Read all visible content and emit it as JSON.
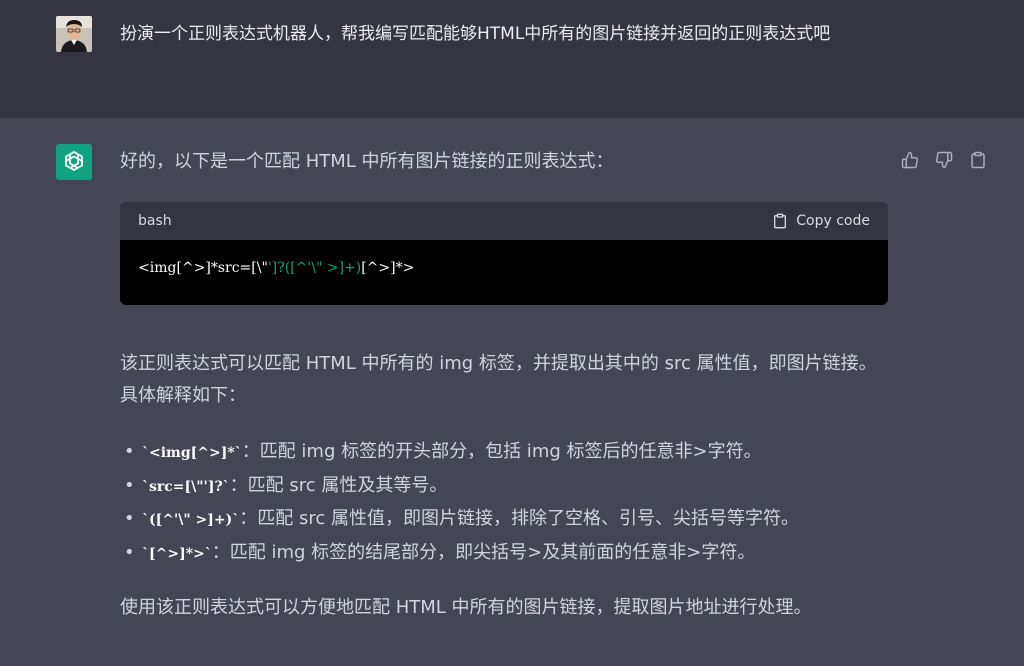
{
  "user_message": {
    "text": "扮演一个正则表达式机器人，帮我编写匹配能够HTML中所有的图片链接并返回的正则表达式吧"
  },
  "assistant_message": {
    "intro": "好的，以下是一个匹配 HTML 中所有图片链接的正则表达式：",
    "code_block": {
      "language": "bash",
      "copy_label": "Copy code",
      "code_part1": "<img[^>]*src=[\\\"",
      "code_part2": "']?([^'\\\" >]+)",
      "code_part3": "[^>]*>"
    },
    "explanation": "该正则表达式可以匹配 HTML 中所有的 img 标签，并提取出其中的 src 属性值，即图片链接。具体解释如下：",
    "bullets": [
      {
        "code": "`<img[^>]*`",
        "text": "：匹配 img 标签的开头部分，包括 img 标签后的任意非>字符。"
      },
      {
        "code": "`src=[\\\"']?`",
        "text": "：匹配 src 属性及其等号。"
      },
      {
        "code": "`([^'\\\" >]+)`",
        "text": "：匹配 src 属性值，即图片链接，排除了空格、引号、尖括号等字符。"
      },
      {
        "code": "`[^>]*>`",
        "text": "：匹配 img 标签的结尾部分，即尖括号>及其前面的任意非>字符。"
      }
    ],
    "conclusion": "使用该正则表达式可以方便地匹配 HTML 中所有的图片链接，提取图片地址进行处理。"
  },
  "icons": {
    "thumbs_up": "thumbs-up-icon",
    "thumbs_down": "thumbs-down-icon",
    "copy": "clipboard-icon",
    "bot_logo": "openai-logo-icon"
  },
  "colors": {
    "user_bg": "#343541",
    "assistant_bg": "#444654",
    "bot_avatar": "#10a37f",
    "code_bg": "#000000",
    "code_header": "#343541",
    "string_green": "#00a67d"
  }
}
